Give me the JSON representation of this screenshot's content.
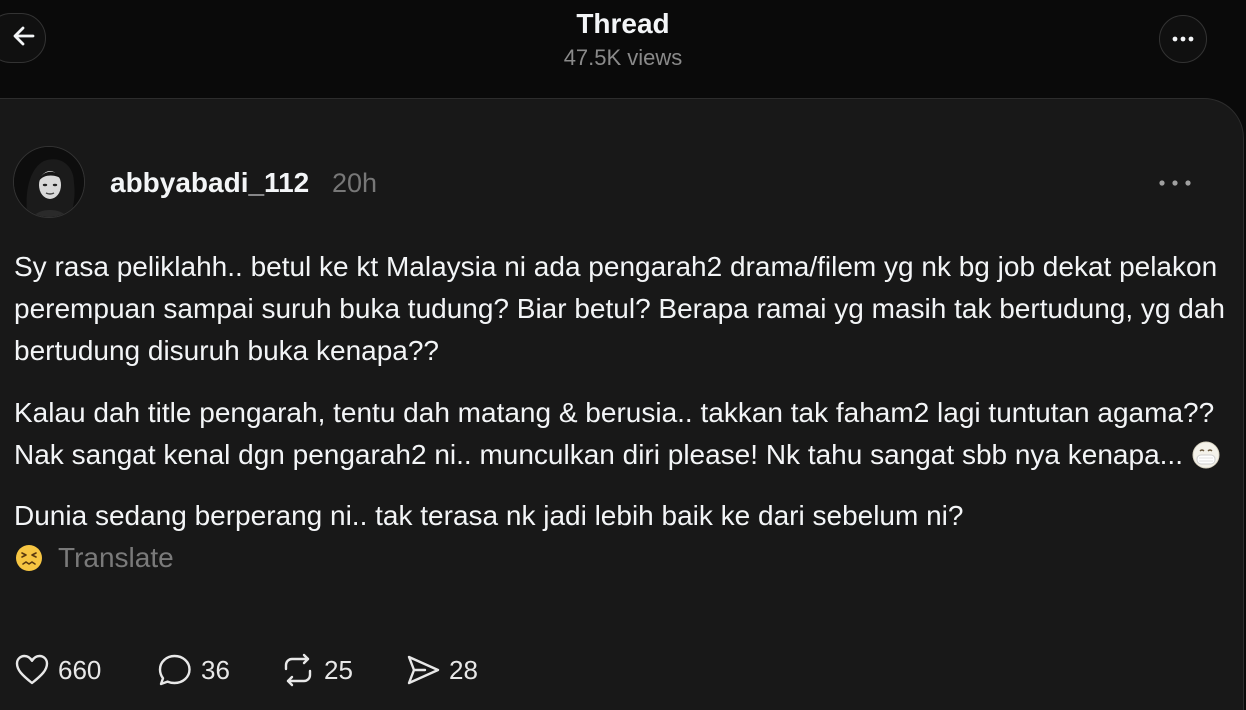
{
  "header": {
    "title": "Thread",
    "views": "47.5K views"
  },
  "post": {
    "username": "abbyabadi_112",
    "time": "20h",
    "paragraphs": [
      "Sy rasa peliklahh.. betul ke kt Malaysia ni ada pengarah2 drama/filem yg nk bg job dekat pelakon perempuan sampai suruh buka tudung? Biar betul? Berapa ramai yg masih tak bertudung, yg dah bertudung disuruh buka kenapa??",
      "Kalau dah title pengarah, tentu dah matang & berusia.. takkan tak faham2 lagi tuntutan agama?? Nak sangat kenal dgn pengarah2 ni.. munculkan diri please! Nk tahu sangat sbb nya kenapa...",
      "Dunia sedang berperang ni.. tak terasa nk jadi lebih baik ke dari sebelum ni?"
    ],
    "translate_label": "Translate"
  },
  "actions": {
    "likes": "660",
    "replies": "36",
    "reposts": "25",
    "shares": "28"
  },
  "icons": {
    "back": "arrow-left-icon",
    "more": "more-horizontal-icon",
    "like": "heart-icon",
    "reply": "comment-icon",
    "repost": "repost-icon",
    "share": "send-icon",
    "emoji1": "face-with-medical-mask-emoji",
    "emoji2": "confounded-face-emoji"
  },
  "colors": {
    "background": "#0a0a0a",
    "card": "#181818",
    "text": "#f3f5f7",
    "muted": "#777777"
  }
}
